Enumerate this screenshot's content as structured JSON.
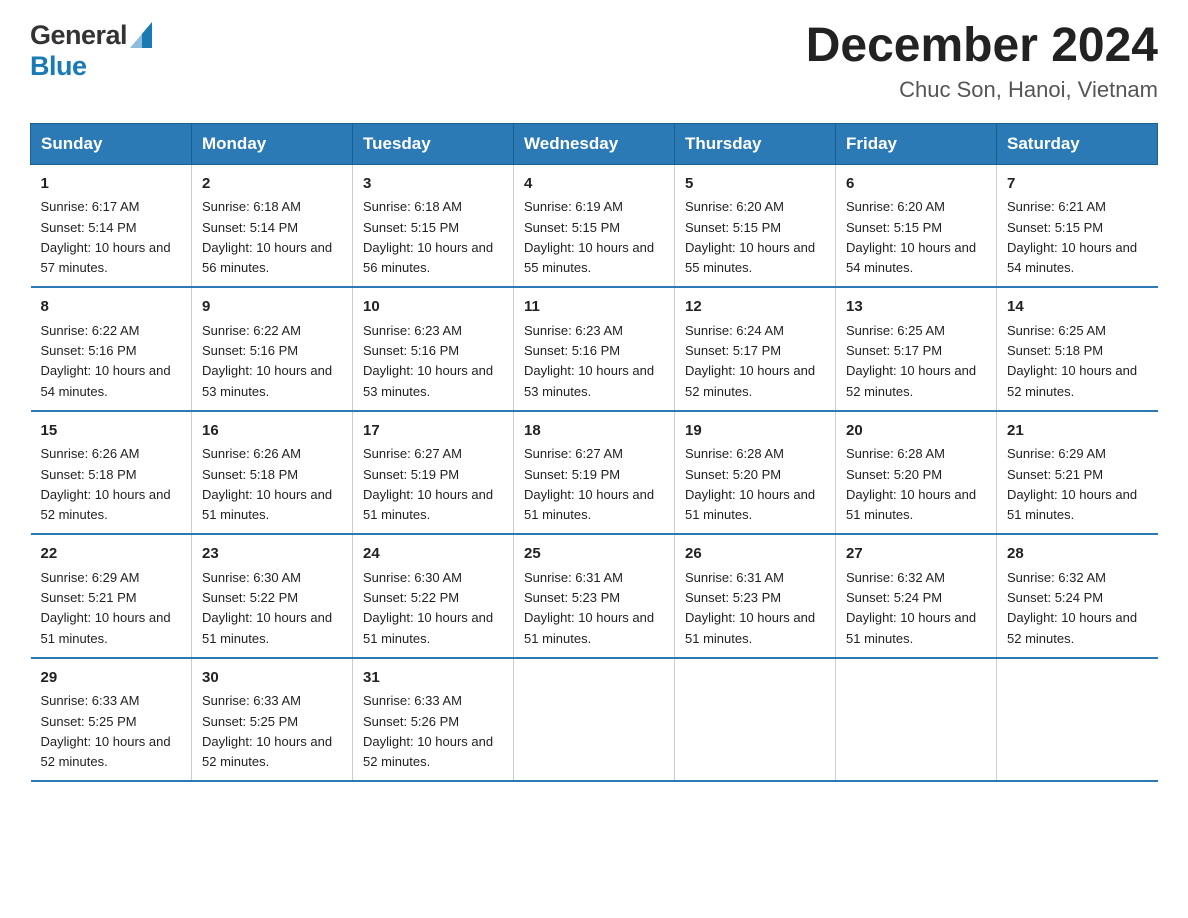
{
  "header": {
    "logo_general": "General",
    "logo_blue": "Blue",
    "month_year": "December 2024",
    "location": "Chuc Son, Hanoi, Vietnam"
  },
  "days_of_week": [
    "Sunday",
    "Monday",
    "Tuesday",
    "Wednesday",
    "Thursday",
    "Friday",
    "Saturday"
  ],
  "weeks": [
    [
      {
        "num": "1",
        "sunrise": "6:17 AM",
        "sunset": "5:14 PM",
        "daylight": "10 hours and 57 minutes."
      },
      {
        "num": "2",
        "sunrise": "6:18 AM",
        "sunset": "5:14 PM",
        "daylight": "10 hours and 56 minutes."
      },
      {
        "num": "3",
        "sunrise": "6:18 AM",
        "sunset": "5:15 PM",
        "daylight": "10 hours and 56 minutes."
      },
      {
        "num": "4",
        "sunrise": "6:19 AM",
        "sunset": "5:15 PM",
        "daylight": "10 hours and 55 minutes."
      },
      {
        "num": "5",
        "sunrise": "6:20 AM",
        "sunset": "5:15 PM",
        "daylight": "10 hours and 55 minutes."
      },
      {
        "num": "6",
        "sunrise": "6:20 AM",
        "sunset": "5:15 PM",
        "daylight": "10 hours and 54 minutes."
      },
      {
        "num": "7",
        "sunrise": "6:21 AM",
        "sunset": "5:15 PM",
        "daylight": "10 hours and 54 minutes."
      }
    ],
    [
      {
        "num": "8",
        "sunrise": "6:22 AM",
        "sunset": "5:16 PM",
        "daylight": "10 hours and 54 minutes."
      },
      {
        "num": "9",
        "sunrise": "6:22 AM",
        "sunset": "5:16 PM",
        "daylight": "10 hours and 53 minutes."
      },
      {
        "num": "10",
        "sunrise": "6:23 AM",
        "sunset": "5:16 PM",
        "daylight": "10 hours and 53 minutes."
      },
      {
        "num": "11",
        "sunrise": "6:23 AM",
        "sunset": "5:16 PM",
        "daylight": "10 hours and 53 minutes."
      },
      {
        "num": "12",
        "sunrise": "6:24 AM",
        "sunset": "5:17 PM",
        "daylight": "10 hours and 52 minutes."
      },
      {
        "num": "13",
        "sunrise": "6:25 AM",
        "sunset": "5:17 PM",
        "daylight": "10 hours and 52 minutes."
      },
      {
        "num": "14",
        "sunrise": "6:25 AM",
        "sunset": "5:18 PM",
        "daylight": "10 hours and 52 minutes."
      }
    ],
    [
      {
        "num": "15",
        "sunrise": "6:26 AM",
        "sunset": "5:18 PM",
        "daylight": "10 hours and 52 minutes."
      },
      {
        "num": "16",
        "sunrise": "6:26 AM",
        "sunset": "5:18 PM",
        "daylight": "10 hours and 51 minutes."
      },
      {
        "num": "17",
        "sunrise": "6:27 AM",
        "sunset": "5:19 PM",
        "daylight": "10 hours and 51 minutes."
      },
      {
        "num": "18",
        "sunrise": "6:27 AM",
        "sunset": "5:19 PM",
        "daylight": "10 hours and 51 minutes."
      },
      {
        "num": "19",
        "sunrise": "6:28 AM",
        "sunset": "5:20 PM",
        "daylight": "10 hours and 51 minutes."
      },
      {
        "num": "20",
        "sunrise": "6:28 AM",
        "sunset": "5:20 PM",
        "daylight": "10 hours and 51 minutes."
      },
      {
        "num": "21",
        "sunrise": "6:29 AM",
        "sunset": "5:21 PM",
        "daylight": "10 hours and 51 minutes."
      }
    ],
    [
      {
        "num": "22",
        "sunrise": "6:29 AM",
        "sunset": "5:21 PM",
        "daylight": "10 hours and 51 minutes."
      },
      {
        "num": "23",
        "sunrise": "6:30 AM",
        "sunset": "5:22 PM",
        "daylight": "10 hours and 51 minutes."
      },
      {
        "num": "24",
        "sunrise": "6:30 AM",
        "sunset": "5:22 PM",
        "daylight": "10 hours and 51 minutes."
      },
      {
        "num": "25",
        "sunrise": "6:31 AM",
        "sunset": "5:23 PM",
        "daylight": "10 hours and 51 minutes."
      },
      {
        "num": "26",
        "sunrise": "6:31 AM",
        "sunset": "5:23 PM",
        "daylight": "10 hours and 51 minutes."
      },
      {
        "num": "27",
        "sunrise": "6:32 AM",
        "sunset": "5:24 PM",
        "daylight": "10 hours and 51 minutes."
      },
      {
        "num": "28",
        "sunrise": "6:32 AM",
        "sunset": "5:24 PM",
        "daylight": "10 hours and 52 minutes."
      }
    ],
    [
      {
        "num": "29",
        "sunrise": "6:33 AM",
        "sunset": "5:25 PM",
        "daylight": "10 hours and 52 minutes."
      },
      {
        "num": "30",
        "sunrise": "6:33 AM",
        "sunset": "5:25 PM",
        "daylight": "10 hours and 52 minutes."
      },
      {
        "num": "31",
        "sunrise": "6:33 AM",
        "sunset": "5:26 PM",
        "daylight": "10 hours and 52 minutes."
      },
      null,
      null,
      null,
      null
    ]
  ]
}
